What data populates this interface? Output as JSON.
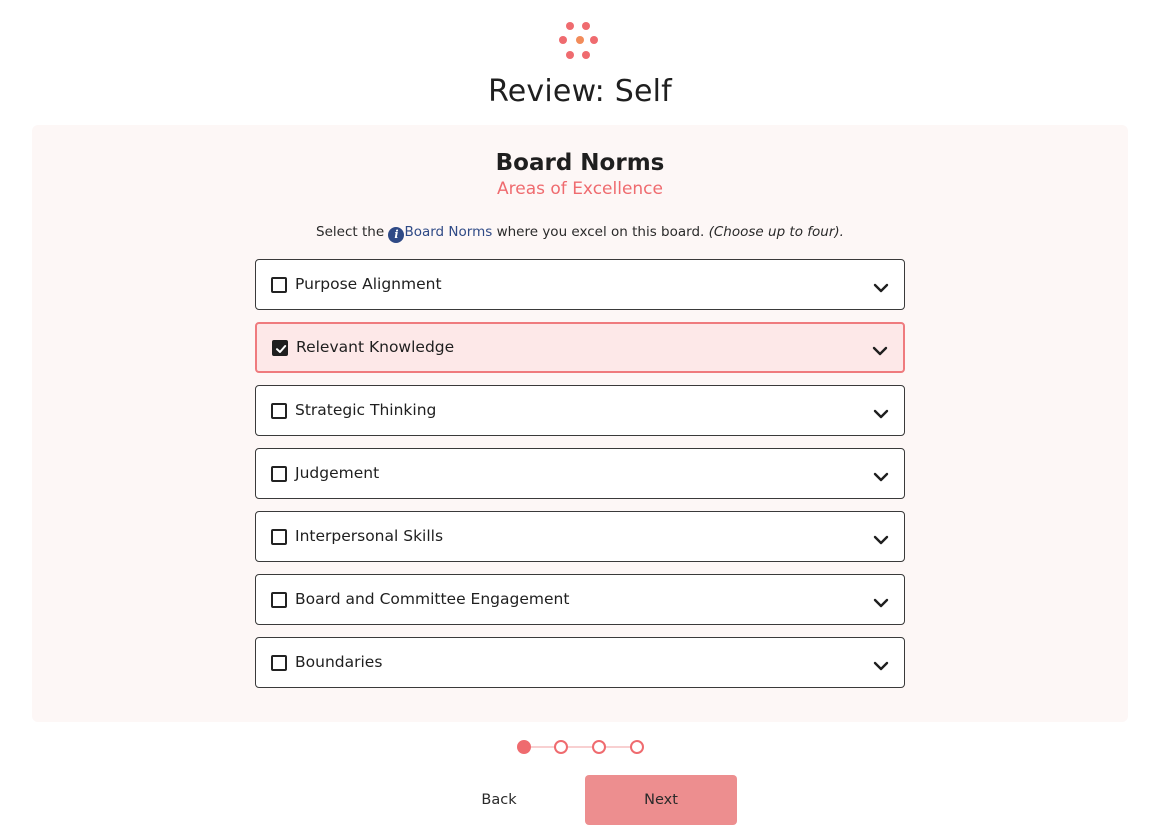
{
  "header": {
    "logo_icon": "dots-flower-logo",
    "title": "Review: Self"
  },
  "section": {
    "title": "Board Norms",
    "subtitle": "Areas of Excellence",
    "instructions": {
      "prefix": "Select the",
      "info_icon": "info-icon",
      "link_text": "Board Norms",
      "suffix": "where you excel on this board.",
      "hint": "(Choose up to four)."
    }
  },
  "norms": [
    {
      "label": "Purpose Alignment",
      "checked": false
    },
    {
      "label": "Relevant Knowledge",
      "checked": true
    },
    {
      "label": "Strategic Thinking",
      "checked": false
    },
    {
      "label": "Judgement",
      "checked": false
    },
    {
      "label": "Interpersonal Skills",
      "checked": false
    },
    {
      "label": "Board and Committee Engagement",
      "checked": false
    },
    {
      "label": "Boundaries",
      "checked": false
    }
  ],
  "stepper": {
    "current_step": 1,
    "total_steps": 4
  },
  "footer": {
    "back_label": "Back",
    "next_label": "Next"
  },
  "colors": {
    "accent": "#ef6b6f",
    "selected_bg": "#fde8e8",
    "link": "#2f4a86",
    "next_button": "#ed8e8f",
    "panel_bg": "#fdf7f6"
  }
}
